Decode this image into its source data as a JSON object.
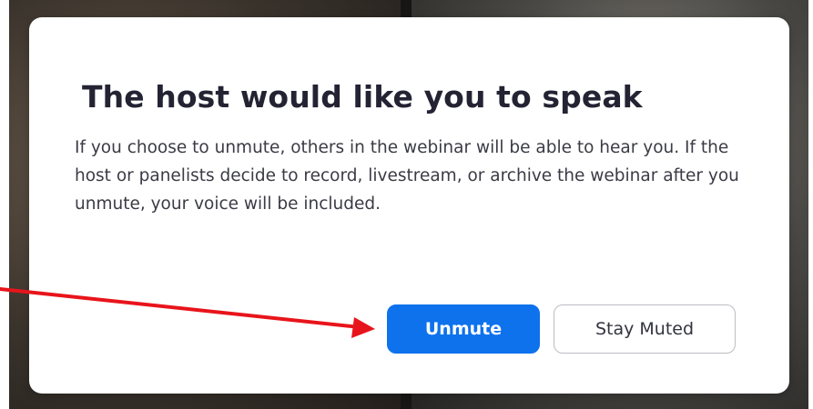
{
  "dialog": {
    "title": "The host would like you to speak",
    "body": "If you choose to unmute, others in the webinar will be able to hear you. If the host or panelists decide to record, livestream, or archive the webinar after you unmute, your voice will be included."
  },
  "buttons": {
    "unmute_label": "Unmute",
    "stay_muted_label": "Stay Muted"
  },
  "colors": {
    "primary": "#0e72ed",
    "annotation_arrow": "#e8141b",
    "title_text": "#232333"
  },
  "annotation": {
    "type": "arrow",
    "points_to": "unmute-button"
  }
}
